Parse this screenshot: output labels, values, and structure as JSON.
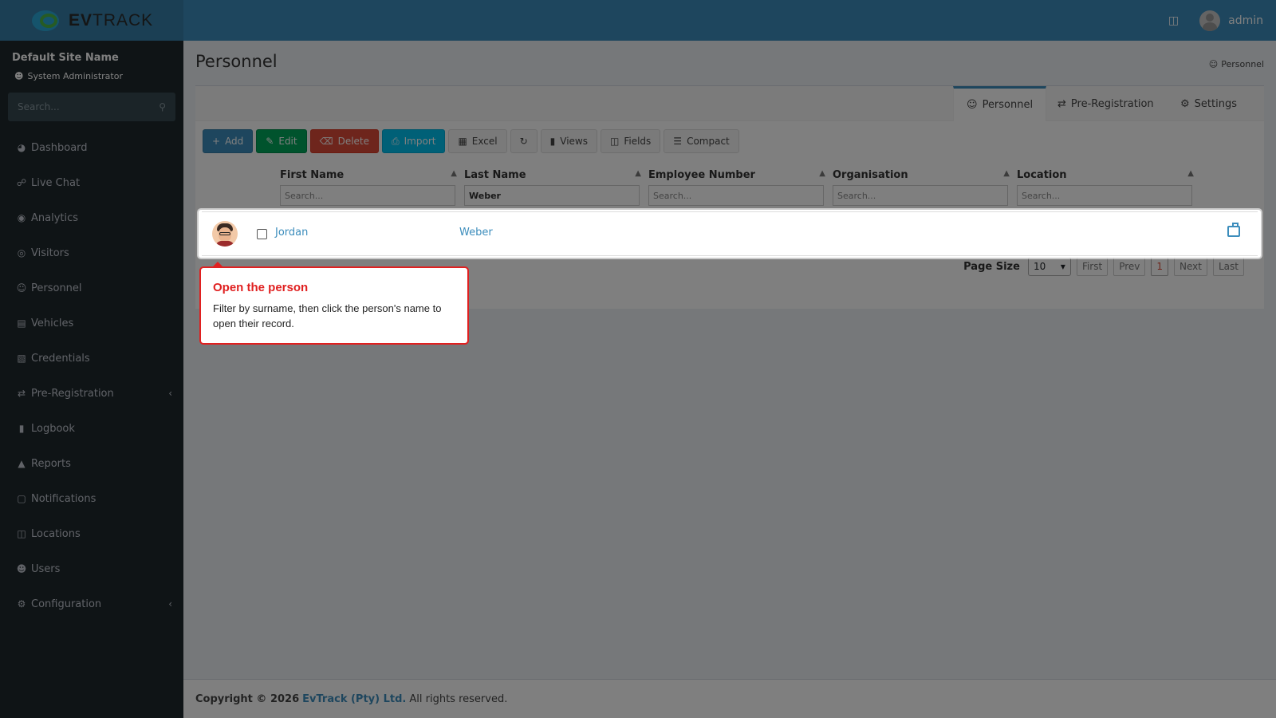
{
  "header": {
    "logo_text_bold": "EV",
    "logo_text": "TRACK",
    "user_name": "admin"
  },
  "sidebar": {
    "site_name": "Default Site Name",
    "role": "System Administrator",
    "search_placeholder": "Search...",
    "items": [
      {
        "label": "Dashboard",
        "icon": "dashboard-icon"
      },
      {
        "label": "Live Chat",
        "icon": "headset-icon"
      },
      {
        "label": "Analytics",
        "icon": "analytics-icon"
      },
      {
        "label": "Visitors",
        "icon": "eye-icon"
      },
      {
        "label": "Personnel",
        "icon": "personnel-icon"
      },
      {
        "label": "Vehicles",
        "icon": "car-icon"
      },
      {
        "label": "Credentials",
        "icon": "id-card-icon"
      },
      {
        "label": "Pre-Registration",
        "icon": "arrows-icon"
      },
      {
        "label": "Logbook",
        "icon": "book-icon"
      },
      {
        "label": "Reports",
        "icon": "chart-icon"
      },
      {
        "label": "Notifications",
        "icon": "bell-icon"
      },
      {
        "label": "Locations",
        "icon": "map-icon"
      },
      {
        "label": "Users",
        "icon": "users-icon"
      },
      {
        "label": "Configuration",
        "icon": "gear-icon"
      }
    ]
  },
  "page": {
    "title": "Personnel",
    "breadcrumb": "Personnel"
  },
  "tabs": [
    {
      "label": "Personnel",
      "active": true
    },
    {
      "label": "Pre-Registration",
      "active": false
    },
    {
      "label": "Settings",
      "active": false
    }
  ],
  "toolbar": {
    "add": "Add",
    "edit": "Edit",
    "delete": "Delete",
    "import": "Import",
    "excel": "Excel",
    "views": "Views",
    "fields": "Fields",
    "compact": "Compact"
  },
  "table": {
    "columns": [
      {
        "header": "First Name",
        "filter_value": "",
        "placeholder": "Search..."
      },
      {
        "header": "Last Name",
        "filter_value": "Weber",
        "placeholder": "Search..."
      },
      {
        "header": "Employee Number",
        "filter_value": "",
        "placeholder": "Search..."
      },
      {
        "header": "Organisation",
        "filter_value": "",
        "placeholder": "Search..."
      },
      {
        "header": "Location",
        "filter_value": "",
        "placeholder": "Search..."
      }
    ],
    "rows": [
      {
        "first_name": "Jordan",
        "last_name": "Weber"
      }
    ]
  },
  "pager": {
    "label": "Page Size",
    "size": "10",
    "first": "First",
    "prev": "Prev",
    "current": "1",
    "next": "Next",
    "last": "Last"
  },
  "footer": {
    "copyright": "Copyright © 2026",
    "company": "EvTrack (Pty) Ltd.",
    "rights": "All rights reserved."
  },
  "tooltip": {
    "title": "Open the person",
    "body": "Filter by surname, then click the person's name to open their record."
  },
  "colors": {
    "accent": "#3c8dbc",
    "tooltip_border": "#e02020",
    "sidebar_bg": "#1e282c"
  }
}
